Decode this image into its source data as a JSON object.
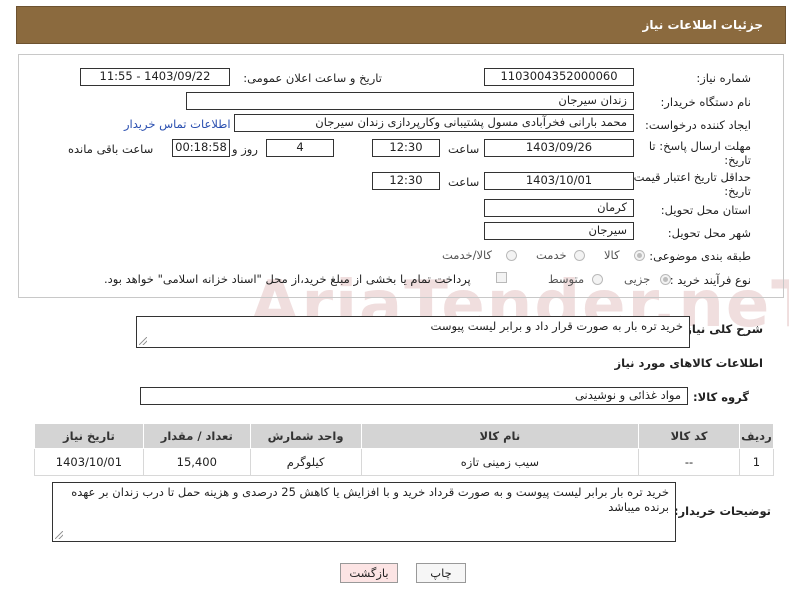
{
  "header": {
    "title": "جزئیات اطلاعات نیاز"
  },
  "watermark": {
    "text": "AriaTender.neT"
  },
  "form": {
    "need_number_label": "شماره نیاز:",
    "need_number": "1103004352000060",
    "announce_label": "تاریخ و ساعت اعلان عمومی:",
    "announce_value": "1403/09/22 - 11:55",
    "buyer_org_label": "نام دستگاه خریدار:",
    "buyer_org": "زندان سیرجان",
    "creator_label": "ایجاد کننده درخواست:",
    "creator": "محمد بارانی فخرآبادی مسول پشتیبانی وکارپردازی زندان سیرجان",
    "contact_link": "اطلاعات تماس خریدار",
    "deadline_label_1": "مهلت ارسال پاسخ: تا",
    "deadline_label_2": "تاریخ:",
    "deadline_date": "1403/09/26",
    "time_label": "ساعت",
    "deadline_time": "12:30",
    "days_value": "4",
    "days_label": "روز و",
    "remaining_time": "00:18:58",
    "remaining_label": "ساعت باقی مانده",
    "min_validity_label_1": "حداقل تاریخ اعتبار قیمت: تا",
    "min_validity_label_2": "تاریخ:",
    "validity_date": "1403/10/01",
    "validity_time": "12:30",
    "province_label": "استان محل تحویل:",
    "province": "کرمان",
    "city_label": "شهر محل تحویل:",
    "city": "سیرجان",
    "category_label": "طبقه بندی موضوعی:",
    "category_options": [
      "کالا",
      "خدمت",
      "کالا/خدمت"
    ],
    "purchase_type_label": "نوع فرآیند خرید :",
    "purchase_options": [
      "جزیی",
      "متوسط"
    ],
    "payment_note": "پرداخت تمام یا بخشی از مبلغ خرید،از محل \"اسناد خزانه اسلامی\" خواهد بود."
  },
  "summary": {
    "label": "شرح کلی نیاز:",
    "text": "خرید تره بار به صورت قرار داد و برابر لیست پیوست"
  },
  "goods_section": {
    "title": "اطلاعات کالاهای مورد نیاز",
    "group_label": "گروه کالا:",
    "group_value": "مواد غذائی و نوشیدنی"
  },
  "table": {
    "headers": [
      "ردیف",
      "کد کالا",
      "نام کالا",
      "واحد شمارش",
      "تعداد / مقدار",
      "تاریخ نیاز"
    ],
    "rows": [
      [
        "1",
        "--",
        "سیب زمینی تازه",
        "کیلوگرم",
        "15,400",
        "1403/10/01"
      ]
    ]
  },
  "buyer_notes": {
    "label": "توضیحات خریدار:",
    "text": "خرید تره بار برابر لیست پیوست و به صورت قرداد خرید و با افزایش یا کاهش 25 درصدی و هزینه حمل تا درب زندان بر عهده برنده میباشد"
  },
  "buttons": {
    "print": "چاپ",
    "back": "بازگشت"
  },
  "colors": {
    "header_bg": "#8b6a3e",
    "back_button_bg": "#fce4e4",
    "link": "#2a4fb0"
  }
}
